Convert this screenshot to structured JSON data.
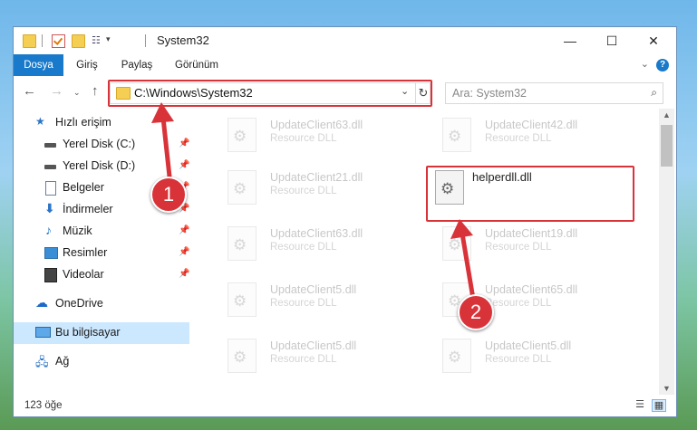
{
  "window": {
    "title": "System32",
    "minimize_label": "—",
    "maximize_label": "☐",
    "close_label": "✕"
  },
  "ribbon": {
    "tabs": [
      "Dosya",
      "Giriş",
      "Paylaş",
      "Görünüm"
    ],
    "help_label": "?"
  },
  "nav": {
    "address": "C:\\Windows\\System32",
    "search_placeholder": "Ara: System32"
  },
  "sidebar": {
    "items": [
      {
        "label": "Hızlı erişim",
        "icon": "star-icon"
      },
      {
        "label": "Yerel Disk (C:)",
        "icon": "drive-icon",
        "pinned": true
      },
      {
        "label": "Yerel Disk (D:)",
        "icon": "drive-icon",
        "pinned": true
      },
      {
        "label": "Belgeler",
        "icon": "documents-icon",
        "pinned": true
      },
      {
        "label": "İndirmeler",
        "icon": "download-icon",
        "pinned": true
      },
      {
        "label": "Müzik",
        "icon": "music-icon",
        "pinned": true
      },
      {
        "label": "Resimler",
        "icon": "pictures-icon",
        "pinned": true
      },
      {
        "label": "Videolar",
        "icon": "video-icon",
        "pinned": true
      },
      {
        "label": "OneDrive",
        "icon": "cloud-icon"
      },
      {
        "label": "Bu bilgisayar",
        "icon": "computer-icon",
        "selected": true
      },
      {
        "label": "Ağ",
        "icon": "network-icon"
      }
    ]
  },
  "files": [
    {
      "name": "UpdateClient63.dll",
      "type": "Resource DLL"
    },
    {
      "name": "UpdateClient42.dll",
      "type": "Resource DLL"
    },
    {
      "name": "UpdateClient21.dll",
      "type": "Resource DLL"
    },
    {
      "name": "helperdll.dll",
      "type": "",
      "highlighted": true
    },
    {
      "name": "UpdateClient63.dll",
      "type": "Resource DLL"
    },
    {
      "name": "UpdateClient19.dll",
      "type": "Resource DLL"
    },
    {
      "name": "UpdateClient5.dll",
      "type": "Resource DLL"
    },
    {
      "name": "UpdateClient65.dll",
      "type": "Resource DLL"
    },
    {
      "name": "UpdateClient5.dll",
      "type": "Resource DLL"
    },
    {
      "name": "UpdateClient5.dll",
      "type": "Resource DLL"
    }
  ],
  "status": {
    "item_count": "123 öğe"
  },
  "annotations": {
    "badge1": "1",
    "badge2": "2",
    "color": "#d9333a"
  }
}
